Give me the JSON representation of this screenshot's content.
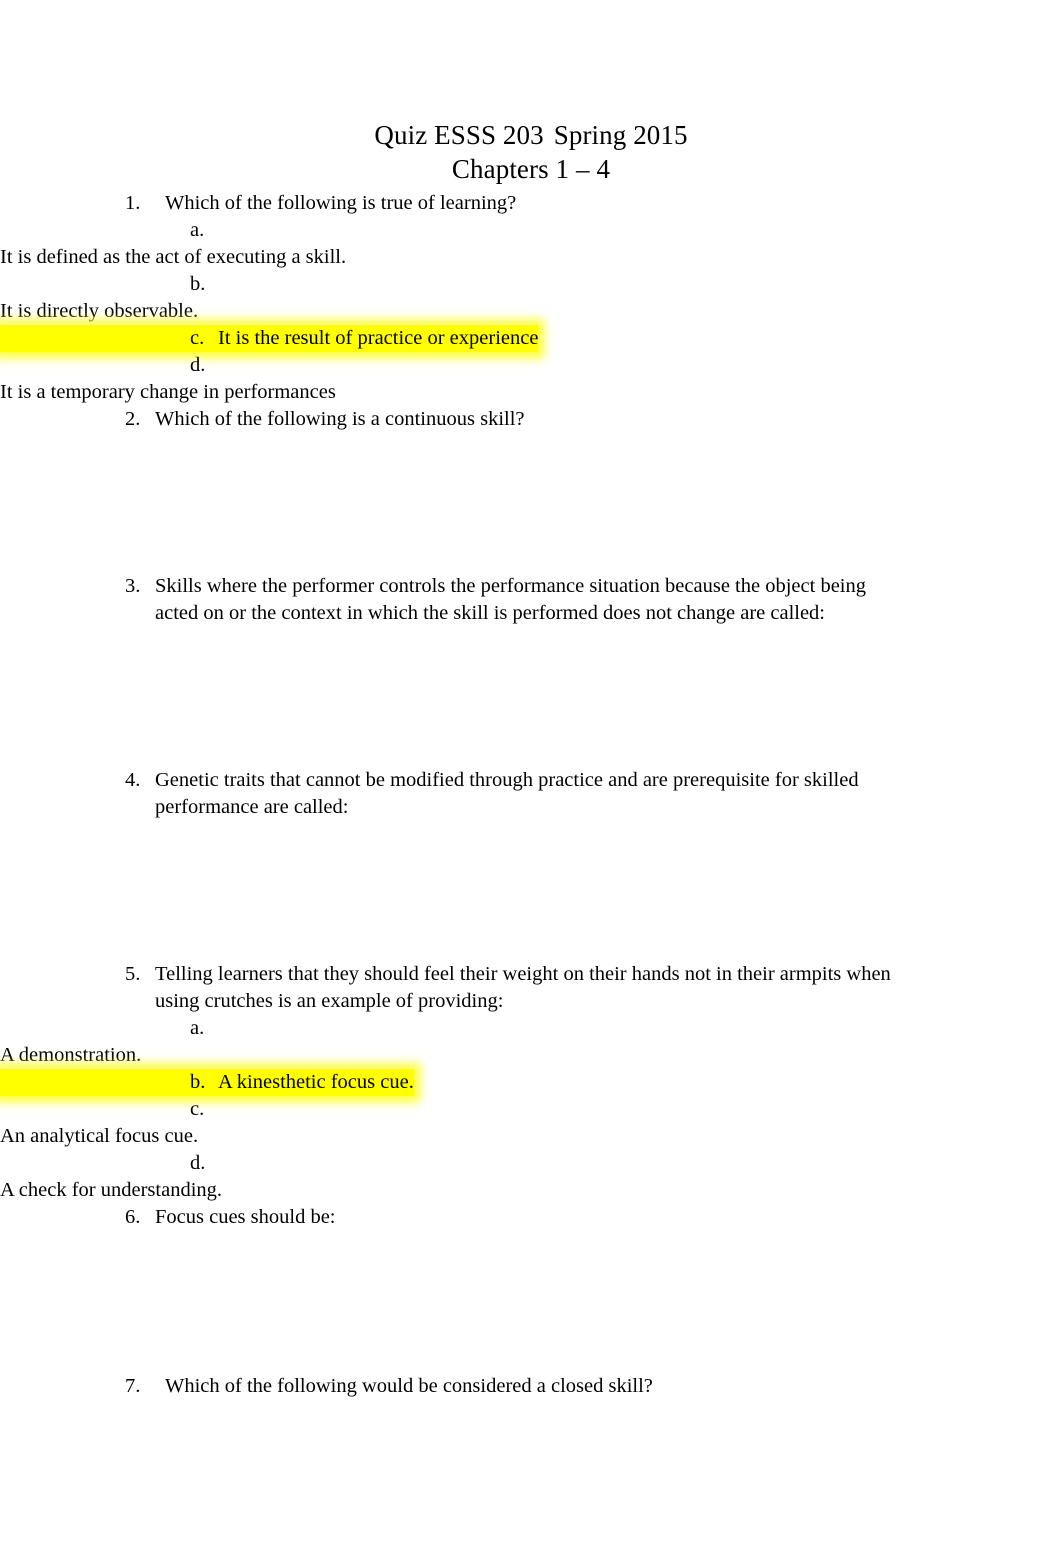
{
  "document": {
    "heading": {
      "line1_part1": "Quiz ESSS 203",
      "line1_part2": "Spring 2015",
      "line2": "Chapters 1 – 4"
    },
    "questions": [
      {
        "number": "1.",
        "text": "Which of the following is true of learning?",
        "options": [
          {
            "letter": "a.",
            "text": "It is defined as the act of executing a skill.",
            "highlighted": false
          },
          {
            "letter": "b.",
            "text": "It is directly observable.",
            "highlighted": false
          },
          {
            "letter": "c.",
            "text": "It is the result of practice or experience",
            "highlighted": true
          },
          {
            "letter": "d.",
            "text": "It is a temporary change in performances",
            "highlighted": false
          }
        ]
      },
      {
        "number": "2.",
        "text": "Which of the following is a continuous skill?",
        "options": []
      },
      {
        "number": "3.",
        "text": "Skills where the performer controls the performance situation because the object being acted on or the context in which the skill is performed does not change are called:",
        "options": []
      },
      {
        "number": "4.",
        "text": "Genetic traits that cannot be modified through practice and are prerequisite for skilled performance are called:",
        "options": []
      },
      {
        "number": "5.",
        "text": "Telling learners that they should feel their weight on their hands not in their armpits when using crutches is an example of providing:",
        "options": [
          {
            "letter": "a.",
            "text": "A demonstration.",
            "highlighted": false
          },
          {
            "letter": "b.",
            "text": "A kinesthetic focus cue.",
            "highlighted": true
          },
          {
            "letter": "c.",
            "text": "An analytical focus cue.",
            "highlighted": false
          },
          {
            "letter": "d.",
            "text": "A check for understanding.",
            "highlighted": false
          }
        ]
      },
      {
        "number": "6.",
        "text": "Focus cues should be:",
        "options": []
      },
      {
        "number": "7.",
        "text": "Which of the following would be considered a closed skill?",
        "options": []
      }
    ],
    "colors": {
      "highlight": "#ffff00",
      "text": "#000000",
      "page_background": "#ffffff"
    }
  }
}
